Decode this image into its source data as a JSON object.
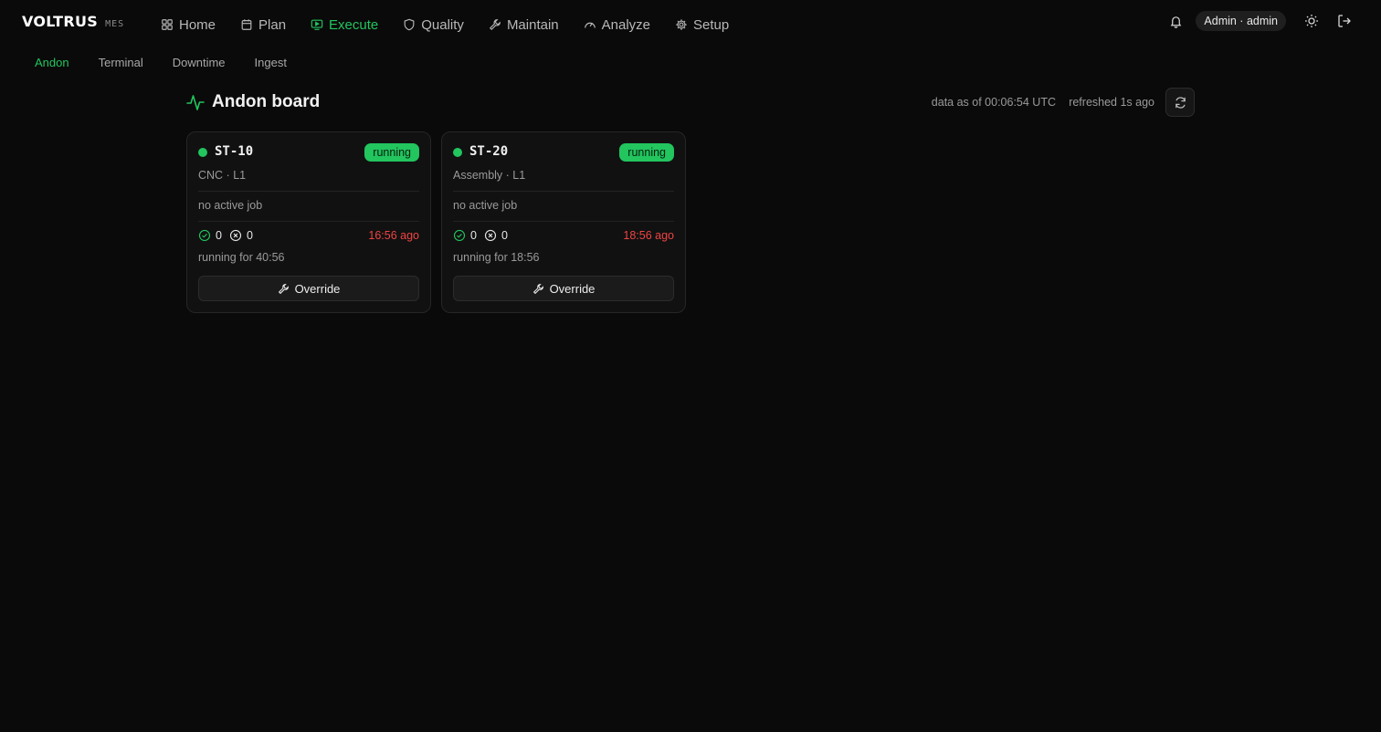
{
  "brand": {
    "name": "VOLTRUS",
    "sub": "MES"
  },
  "nav": {
    "items": [
      {
        "label": "Home",
        "icon": "grid-icon"
      },
      {
        "label": "Plan",
        "icon": "calendar-icon"
      },
      {
        "label": "Execute",
        "icon": "monitor-play-icon",
        "active": true
      },
      {
        "label": "Quality",
        "icon": "shield-icon"
      },
      {
        "label": "Maintain",
        "icon": "wrench-icon"
      },
      {
        "label": "Analyze",
        "icon": "gauge-icon"
      },
      {
        "label": "Setup",
        "icon": "gear-icon"
      }
    ]
  },
  "user": {
    "label": "Admin · admin"
  },
  "subnav": {
    "items": [
      {
        "label": "Andon",
        "active": true
      },
      {
        "label": "Terminal"
      },
      {
        "label": "Downtime"
      },
      {
        "label": "Ingest"
      }
    ]
  },
  "header": {
    "title": "Andon board",
    "data_as_of": "data as of 00:06:54 UTC",
    "refreshed": "refreshed 1s ago"
  },
  "colors": {
    "accent": "#22c55e",
    "danger": "#ef4444",
    "background": "#0a0a0a"
  },
  "stations": [
    {
      "id": "ST-10",
      "status": "running",
      "meta": "CNC · L1",
      "job": "no active job",
      "good": "0",
      "scrap": "0",
      "ago": "16:56 ago",
      "running_for": "running for 40:56",
      "override_label": "Override"
    },
    {
      "id": "ST-20",
      "status": "running",
      "meta": "Assembly · L1",
      "job": "no active job",
      "good": "0",
      "scrap": "0",
      "ago": "18:56 ago",
      "running_for": "running for 18:56",
      "override_label": "Override"
    }
  ]
}
